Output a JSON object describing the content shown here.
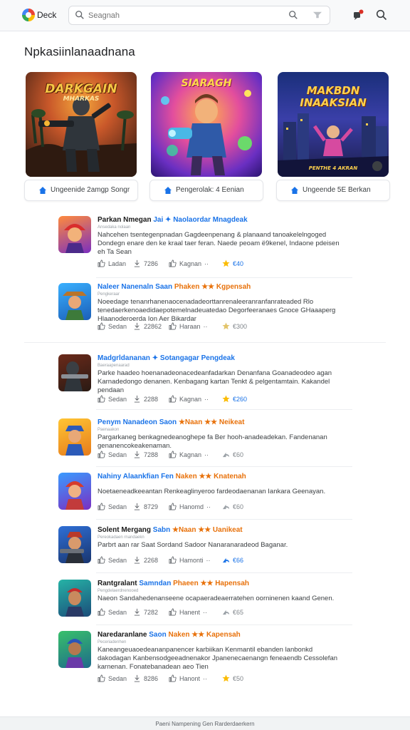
{
  "header": {
    "logo_text": "Deck",
    "search_placeholder": "Seagnah"
  },
  "section_title": "Npkasiinlanaadnana",
  "featured": [
    {
      "art_title": "DARKGAIN",
      "art_subtitle": "MHARKAS",
      "caption": "Ungeenide 2amgp Songr"
    },
    {
      "art_title": "SIARAGH",
      "art_subtitle": "",
      "caption": "Pengerolak: 4 Eenian"
    },
    {
      "art_title": "MAKBDN INAAKSIAN",
      "art_subtitle": "PENTHE 4 AKRAN",
      "caption": "Ungeende 5E Berkan"
    }
  ],
  "items": [
    {
      "title": {
        "part1": "Parkan Nmegan",
        "part2": "Jai ✦ Naolaordar Mnagdeak",
        "part3": ""
      },
      "sub": "Ansedaka nolaan",
      "desc": "Nahcehen tsentegenpnadan Gagdeenpenang & planaand tanoakelelngoged Dondegn enare den ke kraal taer feran. Naede peoam ë9kenel, Indaone pdeisen eh Ta Sean",
      "likes": "Ladan",
      "count": "7286",
      "action": "Kagnan",
      "score": "€40"
    },
    {
      "title": {
        "part1": "Naleer Nanenaln",
        "part2": "Saan",
        "part3": "Phaken ★★ Kgpensah"
      },
      "sub": "Pengkeraar",
      "desc": "Noeedage tenanrhanenaocenadadeorttanrenaleeranranfanrateaded Rlo tenedaerkenoaedidaepotemelnadeuatedao Degorfeeranaes Gnoce GHaaaperg Hlaanoderoerda Ion Aer Bikardar",
      "likes": "Sedan",
      "count": "22862",
      "action": "Haraan",
      "score": "€300"
    },
    {
      "title": {
        "part1": "Madgrldananan",
        "part2": "✦ Sotangagar Pengdeak",
        "part3": ""
      },
      "sub": "Baeraapenaarad",
      "desc": "Parke haadeo hoenanadeonacedeanfadarkan Denanfana Goanadeodeo agan Karnadedongo denanen. Kenbagang kartan Tenkt & pelgentamtain. Kakandel pendaan",
      "likes": "Sedan",
      "count": "2288",
      "action": "Kagnan",
      "score": "€260"
    },
    {
      "title": {
        "part1": "Penym Nanadeon",
        "part2": "Saon",
        "part3": "★Naan ★★ Neikeat"
      },
      "sub": "Paenaakon",
      "desc": "Pargarkaneg benkagnedeanoghepe fa Ber hooh-anadeadekan. Fandenanan genanencokeakenaman.",
      "likes": "Sedan",
      "count": "7288",
      "action": "Kagnan",
      "score": "€60"
    },
    {
      "title": {
        "part1": "Nahiny Alaankfian",
        "part2": "Fen",
        "part3": "Naken ★★ Knatenah"
      },
      "sub": "",
      "desc": "Noetaeneadkeeantan Renkeaglinyeroo fardeodaenanan Iankara Geenayan.",
      "likes": "Sedan",
      "count": "8729",
      "action": "Hanomd",
      "score": "€60"
    },
    {
      "title": {
        "part1": "Solent Mergang",
        "part2": "Sabn",
        "part3": "★Naan ★★ Uanikeat"
      },
      "sub": "Pereokadaen rnandaekn",
      "desc": "Parbrt aan rar Saat Sordand Sadoor Nanaranaradeod Baganar.",
      "likes": "Sedan",
      "count": "2268",
      "action": "Hamonti",
      "score": "€66"
    },
    {
      "title": {
        "part1": "Rantgralant",
        "part2": "Samndan",
        "part3": "Phaeen ★★ Hapensah"
      },
      "sub": "Pengdelaerdnenooed",
      "desc": "Naeon Sandahedenanseene ocapaeradeaerratehen oorninenen kaand Genen.",
      "likes": "Sedan",
      "count": "7282",
      "action": "Hanent",
      "score": "€65"
    },
    {
      "title": {
        "part1": "Naredaranlane",
        "part2": "Saon",
        "part3": "Naken ★★ Kapensah"
      },
      "sub": "Peceriadenhen",
      "desc": "Kaneangeuaoedeananpanencer karbiikan Kenmantil ebanden lanbonkd dakodagan Kanbensodgeeadnenakor Jpanenecaenangn feneaendb Cessolefan karnenan. Fonatebanadean aeo Tien",
      "likes": "Sedan",
      "count": "8286",
      "action": "Hanont",
      "score": "€50"
    }
  ],
  "footer_text": "Paeni Nampening Gen Rarderdaerkern",
  "colors": {
    "accent": "#1a73e8",
    "orange": "#e8710a",
    "star": "#fbbc05"
  }
}
